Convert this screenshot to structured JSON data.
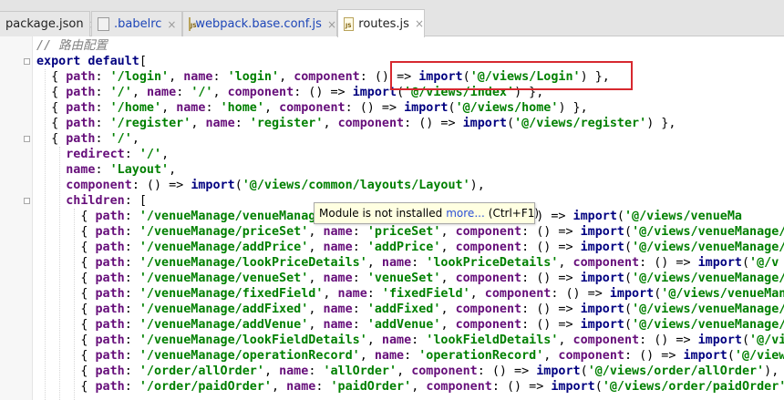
{
  "tabs": [
    {
      "label": "package.json",
      "icon": "json-file-icon",
      "active": false,
      "link": false
    },
    {
      "label": ".babelrc",
      "icon": "babelrc-file-icon",
      "active": false,
      "link": true
    },
    {
      "label": "webpack.base.conf.js",
      "icon": "js-file-icon",
      "active": false,
      "link": true
    },
    {
      "label": "routes.js",
      "icon": "js-file-icon",
      "active": true,
      "link": false
    }
  ],
  "tab_close_glyph": "×",
  "tab_icon_text": "JS",
  "code_lines": [
    [
      {
        "t": "// 路由配置",
        "c": "cm"
      }
    ],
    [
      {
        "t": "export default",
        "c": "kw"
      },
      {
        "t": "["
      }
    ],
    [
      {
        "t": "  { "
      },
      {
        "t": "path",
        "c": "prop"
      },
      {
        "t": ": "
      },
      {
        "t": "'/login'",
        "c": "str"
      },
      {
        "t": ", "
      },
      {
        "t": "name",
        "c": "prop"
      },
      {
        "t": ": "
      },
      {
        "t": "'login'",
        "c": "str"
      },
      {
        "t": ", "
      },
      {
        "t": "component",
        "c": "prop"
      },
      {
        "t": ": () "
      },
      {
        "t": "=> "
      },
      {
        "t": "import",
        "c": "fn"
      },
      {
        "t": "("
      },
      {
        "t": "'@/views/Login'",
        "c": "str"
      },
      {
        "t": ") },"
      }
    ],
    [
      {
        "t": "  { "
      },
      {
        "t": "path",
        "c": "prop"
      },
      {
        "t": ": "
      },
      {
        "t": "'/'",
        "c": "str"
      },
      {
        "t": ", "
      },
      {
        "t": "name",
        "c": "prop"
      },
      {
        "t": ": "
      },
      {
        "t": "'/'",
        "c": "str"
      },
      {
        "t": ", "
      },
      {
        "t": "component",
        "c": "prop"
      },
      {
        "t": ": () => "
      },
      {
        "t": "import",
        "c": "fn"
      },
      {
        "t": "("
      },
      {
        "t": "'@/views/index'",
        "c": "str"
      },
      {
        "t": ") },"
      }
    ],
    [
      {
        "t": "  { "
      },
      {
        "t": "path",
        "c": "prop"
      },
      {
        "t": ": "
      },
      {
        "t": "'/home'",
        "c": "str"
      },
      {
        "t": ", "
      },
      {
        "t": "name",
        "c": "prop"
      },
      {
        "t": ": "
      },
      {
        "t": "'home'",
        "c": "str"
      },
      {
        "t": ", "
      },
      {
        "t": "component",
        "c": "prop"
      },
      {
        "t": ": () => "
      },
      {
        "t": "import",
        "c": "fn"
      },
      {
        "t": "("
      },
      {
        "t": "'@/views/home'",
        "c": "str"
      },
      {
        "t": ") },"
      }
    ],
    [
      {
        "t": "  { "
      },
      {
        "t": "path",
        "c": "prop"
      },
      {
        "t": ": "
      },
      {
        "t": "'/register'",
        "c": "str"
      },
      {
        "t": ", "
      },
      {
        "t": "name",
        "c": "prop"
      },
      {
        "t": ": "
      },
      {
        "t": "'register'",
        "c": "str"
      },
      {
        "t": ", "
      },
      {
        "t": "component",
        "c": "prop"
      },
      {
        "t": ": () => "
      },
      {
        "t": "import",
        "c": "fn"
      },
      {
        "t": "("
      },
      {
        "t": "'@/views/register'",
        "c": "str"
      },
      {
        "t": ") },"
      }
    ],
    [
      {
        "t": "  { "
      },
      {
        "t": "path",
        "c": "prop"
      },
      {
        "t": ": "
      },
      {
        "t": "'/'",
        "c": "str"
      },
      {
        "t": ","
      }
    ],
    [
      {
        "t": "    "
      },
      {
        "t": "redirect",
        "c": "prop"
      },
      {
        "t": ": "
      },
      {
        "t": "'/'",
        "c": "str"
      },
      {
        "t": ","
      }
    ],
    [
      {
        "t": "    "
      },
      {
        "t": "name",
        "c": "prop"
      },
      {
        "t": ": "
      },
      {
        "t": "'Layout'",
        "c": "str"
      },
      {
        "t": ","
      }
    ],
    [
      {
        "t": "    "
      },
      {
        "t": "component",
        "c": "prop"
      },
      {
        "t": ": () => "
      },
      {
        "t": "import",
        "c": "fn"
      },
      {
        "t": "("
      },
      {
        "t": "'@/views/common/layouts/Layout'",
        "c": "str"
      },
      {
        "t": "),"
      }
    ],
    [
      {
        "t": "    "
      },
      {
        "t": "children",
        "c": "prop"
      },
      {
        "t": ": ["
      }
    ],
    [
      {
        "t": "      { "
      },
      {
        "t": "path",
        "c": "prop"
      },
      {
        "t": ": "
      },
      {
        "t": "'/venueManage/venueManag",
        "c": "str"
      },
      {
        "t": "                       "
      },
      {
        "t": "nent",
        "c": "prop"
      },
      {
        "t": ": () => "
      },
      {
        "t": "import",
        "c": "fn"
      },
      {
        "t": "("
      },
      {
        "t": "'@/views/venueMa",
        "c": "str"
      }
    ],
    [
      {
        "t": "      { "
      },
      {
        "t": "path",
        "c": "prop"
      },
      {
        "t": ": "
      },
      {
        "t": "'/venueManage/priceSet'",
        "c": "str"
      },
      {
        "t": ", "
      },
      {
        "t": "name",
        "c": "prop"
      },
      {
        "t": ": "
      },
      {
        "t": "'priceSet'",
        "c": "str"
      },
      {
        "t": ", "
      },
      {
        "t": "component",
        "c": "prop"
      },
      {
        "t": ": () => "
      },
      {
        "t": "import",
        "c": "fn"
      },
      {
        "t": "("
      },
      {
        "t": "'@/views/venueManage/p",
        "c": "str"
      }
    ],
    [
      {
        "t": "      { "
      },
      {
        "t": "path",
        "c": "prop"
      },
      {
        "t": ": "
      },
      {
        "t": "'/venueManage/addPrice'",
        "c": "str"
      },
      {
        "t": ", "
      },
      {
        "t": "name",
        "c": "prop"
      },
      {
        "t": ": "
      },
      {
        "t": "'addPrice'",
        "c": "str"
      },
      {
        "t": ", "
      },
      {
        "t": "component",
        "c": "prop"
      },
      {
        "t": ": () => "
      },
      {
        "t": "import",
        "c": "fn"
      },
      {
        "t": "("
      },
      {
        "t": "'@/views/venueManage/a",
        "c": "str"
      }
    ],
    [
      {
        "t": "      { "
      },
      {
        "t": "path",
        "c": "prop"
      },
      {
        "t": ": "
      },
      {
        "t": "'/venueManage/lookPriceDetails'",
        "c": "str"
      },
      {
        "t": ", "
      },
      {
        "t": "name",
        "c": "prop"
      },
      {
        "t": ": "
      },
      {
        "t": "'lookPriceDetails'",
        "c": "str"
      },
      {
        "t": ", "
      },
      {
        "t": "component",
        "c": "prop"
      },
      {
        "t": ": () => "
      },
      {
        "t": "import",
        "c": "fn"
      },
      {
        "t": "("
      },
      {
        "t": "'@/v",
        "c": "str"
      }
    ],
    [
      {
        "t": "      { "
      },
      {
        "t": "path",
        "c": "prop"
      },
      {
        "t": ": "
      },
      {
        "t": "'/venueManage/venueSet'",
        "c": "str"
      },
      {
        "t": ", "
      },
      {
        "t": "name",
        "c": "prop"
      },
      {
        "t": ": "
      },
      {
        "t": "'venueSet'",
        "c": "str"
      },
      {
        "t": ", "
      },
      {
        "t": "component",
        "c": "prop"
      },
      {
        "t": ": () => "
      },
      {
        "t": "import",
        "c": "fn"
      },
      {
        "t": "("
      },
      {
        "t": "'@/views/venueManage/v",
        "c": "str"
      }
    ],
    [
      {
        "t": "      { "
      },
      {
        "t": "path",
        "c": "prop"
      },
      {
        "t": ": "
      },
      {
        "t": "'/venueManage/fixedField'",
        "c": "str"
      },
      {
        "t": ", "
      },
      {
        "t": "name",
        "c": "prop"
      },
      {
        "t": ": "
      },
      {
        "t": "'fixedField'",
        "c": "str"
      },
      {
        "t": ", "
      },
      {
        "t": "component",
        "c": "prop"
      },
      {
        "t": ": () => "
      },
      {
        "t": "import",
        "c": "fn"
      },
      {
        "t": "("
      },
      {
        "t": "'@/views/venueMana",
        "c": "str"
      }
    ],
    [
      {
        "t": "      { "
      },
      {
        "t": "path",
        "c": "prop"
      },
      {
        "t": ": "
      },
      {
        "t": "'/venueManage/addFixed'",
        "c": "str"
      },
      {
        "t": ", "
      },
      {
        "t": "name",
        "c": "prop"
      },
      {
        "t": ": "
      },
      {
        "t": "'addFixed'",
        "c": "str"
      },
      {
        "t": ", "
      },
      {
        "t": "component",
        "c": "prop"
      },
      {
        "t": ": () => "
      },
      {
        "t": "import",
        "c": "fn"
      },
      {
        "t": "("
      },
      {
        "t": "'@/views/venueManage/a",
        "c": "str"
      }
    ],
    [
      {
        "t": "      { "
      },
      {
        "t": "path",
        "c": "prop"
      },
      {
        "t": ": "
      },
      {
        "t": "'/venueManage/addVenue'",
        "c": "str"
      },
      {
        "t": ", "
      },
      {
        "t": "name",
        "c": "prop"
      },
      {
        "t": ": "
      },
      {
        "t": "'addVenue'",
        "c": "str"
      },
      {
        "t": ", "
      },
      {
        "t": "component",
        "c": "prop"
      },
      {
        "t": ": () => "
      },
      {
        "t": "import",
        "c": "fn"
      },
      {
        "t": "("
      },
      {
        "t": "'@/views/venueManage/a",
        "c": "str"
      }
    ],
    [
      {
        "t": "      { "
      },
      {
        "t": "path",
        "c": "prop"
      },
      {
        "t": ": "
      },
      {
        "t": "'/venueManage/lookFieldDetails'",
        "c": "str"
      },
      {
        "t": ", "
      },
      {
        "t": "name",
        "c": "prop"
      },
      {
        "t": ": "
      },
      {
        "t": "'lookFieldDetails'",
        "c": "str"
      },
      {
        "t": ", "
      },
      {
        "t": "component",
        "c": "prop"
      },
      {
        "t": ": () => "
      },
      {
        "t": "import",
        "c": "fn"
      },
      {
        "t": "("
      },
      {
        "t": "'@/vie",
        "c": "str"
      }
    ],
    [
      {
        "t": "      { "
      },
      {
        "t": "path",
        "c": "prop"
      },
      {
        "t": ": "
      },
      {
        "t": "'/venueManage/operationRecord'",
        "c": "str"
      },
      {
        "t": ", "
      },
      {
        "t": "name",
        "c": "prop"
      },
      {
        "t": ": "
      },
      {
        "t": "'operationRecord'",
        "c": "str"
      },
      {
        "t": ", "
      },
      {
        "t": "component",
        "c": "prop"
      },
      {
        "t": ": () => "
      },
      {
        "t": "import",
        "c": "fn"
      },
      {
        "t": "("
      },
      {
        "t": "'@/views/",
        "c": "str"
      }
    ],
    [
      {
        "t": "      { "
      },
      {
        "t": "path",
        "c": "prop"
      },
      {
        "t": ": "
      },
      {
        "t": "'/order/allOrder'",
        "c": "str"
      },
      {
        "t": ", "
      },
      {
        "t": "name",
        "c": "prop"
      },
      {
        "t": ": "
      },
      {
        "t": "'allOrder'",
        "c": "str"
      },
      {
        "t": ", "
      },
      {
        "t": "component",
        "c": "prop"
      },
      {
        "t": ": () => "
      },
      {
        "t": "import",
        "c": "fn"
      },
      {
        "t": "("
      },
      {
        "t": "'@/views/order/allOrder'",
        "c": "str"
      },
      {
        "t": "),"
      }
    ],
    [
      {
        "t": "      { "
      },
      {
        "t": "path",
        "c": "prop"
      },
      {
        "t": ": "
      },
      {
        "t": "'/order/paidOrder'",
        "c": "str"
      },
      {
        "t": ", "
      },
      {
        "t": "name",
        "c": "prop"
      },
      {
        "t": ": "
      },
      {
        "t": "'paidOrder'",
        "c": "str"
      },
      {
        "t": ", "
      },
      {
        "t": "component",
        "c": "prop"
      },
      {
        "t": ": () => "
      },
      {
        "t": "import",
        "c": "fn"
      },
      {
        "t": "("
      },
      {
        "t": "'@/views/order/paidOrder'",
        "c": "str"
      }
    ]
  ],
  "tooltip": {
    "text": "Module is not installed",
    "link": "more...",
    "shortcut": "(Ctrl+F1)"
  },
  "colors": {
    "keyword": "#000080",
    "property": "#660e7a",
    "string": "#008000",
    "comment": "#808080",
    "highlight_box": "#d7282f",
    "tooltip_bg": "#ffffe1"
  }
}
